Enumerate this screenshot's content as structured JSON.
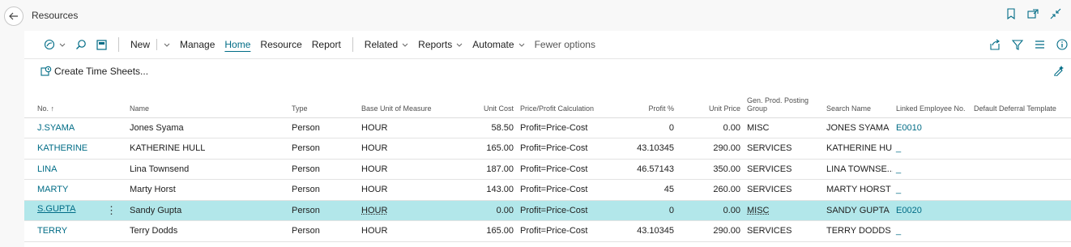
{
  "window": {
    "title": "Resources"
  },
  "actions": {
    "new": "New",
    "manage": "Manage",
    "home": "Home",
    "resource": "Resource",
    "report": "Report",
    "related": "Related",
    "reports": "Reports",
    "automate": "Automate",
    "fewer": "Fewer options"
  },
  "promoted": {
    "create_time_sheets": "Create Time Sheets..."
  },
  "columns": {
    "no": "No. ↑",
    "name": "Name",
    "type": "Type",
    "base_unit": "Base Unit of Measure",
    "unit_cost": "Unit Cost",
    "price_calc": "Price/Profit Calculation",
    "profit_pct": "Profit %",
    "unit_price": "Unit Price",
    "gen_prod": "Gen. Prod. Posting Group",
    "search_name": "Search Name",
    "linked_emp": "Linked Employee No.",
    "deferral": "Default Deferral Template"
  },
  "rows": [
    {
      "no": "J.SYAMA",
      "name": "Jones Syama",
      "type": "Person",
      "unit": "HOUR",
      "cost": "58.50",
      "calc": "Profit=Price-Cost",
      "profit": "0",
      "price": "0.00",
      "group": "MISC",
      "search": "JONES SYAMA",
      "emp": "E0010",
      "deferral": ""
    },
    {
      "no": "KATHERINE",
      "name": "KATHERINE HULL",
      "type": "Person",
      "unit": "HOUR",
      "cost": "165.00",
      "calc": "Profit=Price-Cost",
      "profit": "43.10345",
      "price": "290.00",
      "group": "SERVICES",
      "search": "KATHERINE HULL",
      "emp": "_",
      "deferral": ""
    },
    {
      "no": "LINA",
      "name": "Lina Townsend",
      "type": "Person",
      "unit": "HOUR",
      "cost": "187.00",
      "calc": "Profit=Price-Cost",
      "profit": "46.57143",
      "price": "350.00",
      "group": "SERVICES",
      "search": "LINA TOWNSE...",
      "emp": "_",
      "deferral": ""
    },
    {
      "no": "MARTY",
      "name": "Marty Horst",
      "type": "Person",
      "unit": "HOUR",
      "cost": "143.00",
      "calc": "Profit=Price-Cost",
      "profit": "45",
      "price": "260.00",
      "group": "SERVICES",
      "search": "MARTY HORST",
      "emp": "_",
      "deferral": ""
    },
    {
      "no": "S.GUPTA",
      "name": "Sandy Gupta",
      "type": "Person",
      "unit": "HOUR",
      "cost": "0.00",
      "calc": "Profit=Price-Cost",
      "profit": "0",
      "price": "0.00",
      "group": "MISC",
      "search": "SANDY GUPTA",
      "emp": "E0020",
      "deferral": ""
    },
    {
      "no": "TERRY",
      "name": "Terry Dodds",
      "type": "Person",
      "unit": "HOUR",
      "cost": "165.00",
      "calc": "Profit=Price-Cost",
      "profit": "43.10345",
      "price": "290.00",
      "group": "SERVICES",
      "search": "TERRY DODDS",
      "emp": "_",
      "deferral": ""
    }
  ],
  "selected_row_index": 4,
  "colors": {
    "accent": "#006c86",
    "selected_row": "#b2e7ea",
    "background": "#f8f8f8"
  },
  "icons": [
    "back-arrow-icon",
    "bookmark-icon",
    "open-new-window-icon",
    "collapse-icon",
    "copilot-icon",
    "search-icon",
    "edit-list-icon",
    "create-time-sheets-icon",
    "share-icon",
    "filter-icon",
    "list-view-icon",
    "info-icon",
    "personalize-icon"
  ]
}
